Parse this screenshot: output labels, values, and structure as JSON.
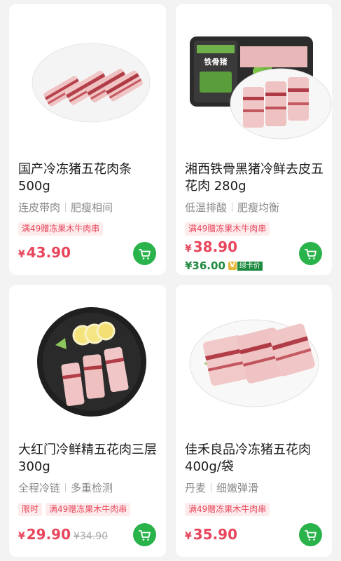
{
  "products": [
    {
      "title": "国产冷冻猪五花肉条500g",
      "features": [
        "连皮带肉",
        "肥瘦相间"
      ],
      "tags": [
        "满49赠冻果木牛肉串"
      ],
      "price_symbol": "¥",
      "price": "43.90",
      "original_price": "",
      "image_icon": "pork-belly-strips-on-white-plate"
    },
    {
      "title": "湘西铁骨黑猪冷鲜去皮五花肉 280g",
      "features": [
        "低温排酸",
        "肥瘦均衡"
      ],
      "tags": [
        "满49赠冻果木牛肉串"
      ],
      "price_symbol": "¥",
      "price": "38.90",
      "member_price": "¥36.00",
      "member_v": "V",
      "member_label": "绿卡价",
      "image_icon": "packaged-pork-with-plate",
      "package_brand": "铁骨猪"
    },
    {
      "title": "大红门冷鲜精五花肉三层 300g",
      "features": [
        "全程冷链",
        "多重检测"
      ],
      "tags": [
        "限时",
        "满49赠冻果木牛肉串"
      ],
      "price_symbol": "¥",
      "price": "29.90",
      "original_price": "¥34.90",
      "image_icon": "pork-strips-on-black-plate-with-lemon"
    },
    {
      "title": "佳禾良品冷冻猪五花肉400g/袋",
      "features": [
        "丹麦",
        "细嫩弹滑"
      ],
      "tags": [
        "满49赠冻果木牛肉串"
      ],
      "price_symbol": "¥",
      "price": "35.90",
      "original_price": "",
      "image_icon": "pork-belly-on-white-plate-with-herb"
    }
  ],
  "colors": {
    "price": "#e8465c",
    "cart": "#29b34a",
    "member": "#1d8a3f"
  },
  "cart_icon": "shopping-cart-icon"
}
